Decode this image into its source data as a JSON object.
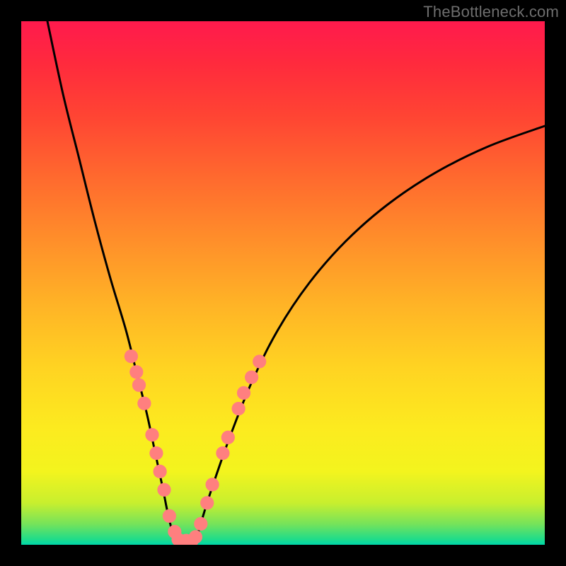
{
  "watermark": "TheBottleneck.com",
  "chart_data": {
    "type": "line",
    "title": "",
    "xlabel": "",
    "ylabel": "",
    "xlim": [
      0,
      100
    ],
    "ylim": [
      0,
      100
    ],
    "grid": false,
    "legend": false,
    "background_gradient": {
      "direction": "vertical",
      "stops": [
        {
          "pct": 0,
          "color": "#ff1a4d"
        },
        {
          "pct": 50,
          "color": "#ffb326"
        },
        {
          "pct": 85,
          "color": "#f3f41e"
        },
        {
          "pct": 100,
          "color": "#00d8aa"
        }
      ]
    },
    "series": [
      {
        "name": "left-branch",
        "color": "#000000",
        "x": [
          5,
          8,
          11,
          14,
          17,
          20,
          22,
          24,
          25.5,
          27,
          28,
          29,
          29.8
        ],
        "y": [
          100,
          86,
          74,
          62,
          51,
          41,
          33,
          25,
          18,
          11,
          6,
          2,
          0
        ]
      },
      {
        "name": "right-branch",
        "color": "#000000",
        "x": [
          33.2,
          34,
          35.5,
          37.5,
          40,
          44,
          49,
          55,
          62,
          70,
          79,
          89,
          100
        ],
        "y": [
          0,
          3,
          8,
          14,
          21,
          31,
          41,
          50,
          58,
          65,
          71,
          76,
          80
        ]
      },
      {
        "name": "valley-flat",
        "color": "#000000",
        "x": [
          29.8,
          31.5,
          33.2
        ],
        "y": [
          0,
          0,
          0
        ]
      }
    ],
    "scatter_overlay": {
      "name": "dots",
      "color": "#ff7f7f",
      "radius_pct": 1.3,
      "points": [
        {
          "x": 21.0,
          "y": 36.0
        },
        {
          "x": 22.0,
          "y": 33.0
        },
        {
          "x": 22.5,
          "y": 30.5
        },
        {
          "x": 23.5,
          "y": 27.0
        },
        {
          "x": 25.0,
          "y": 21.0
        },
        {
          "x": 25.8,
          "y": 17.5
        },
        {
          "x": 26.5,
          "y": 14.0
        },
        {
          "x": 27.3,
          "y": 10.5
        },
        {
          "x": 28.3,
          "y": 5.5
        },
        {
          "x": 29.3,
          "y": 2.5
        },
        {
          "x": 30.0,
          "y": 1.0
        },
        {
          "x": 31.5,
          "y": 0.8
        },
        {
          "x": 32.6,
          "y": 0.8
        },
        {
          "x": 33.3,
          "y": 1.5
        },
        {
          "x": 34.3,
          "y": 4.0
        },
        {
          "x": 35.5,
          "y": 8.0
        },
        {
          "x": 36.5,
          "y": 11.5
        },
        {
          "x": 38.5,
          "y": 17.5
        },
        {
          "x": 39.5,
          "y": 20.5
        },
        {
          "x": 41.5,
          "y": 26.0
        },
        {
          "x": 42.5,
          "y": 29.0
        },
        {
          "x": 44.0,
          "y": 32.0
        },
        {
          "x": 45.5,
          "y": 35.0
        }
      ]
    }
  }
}
